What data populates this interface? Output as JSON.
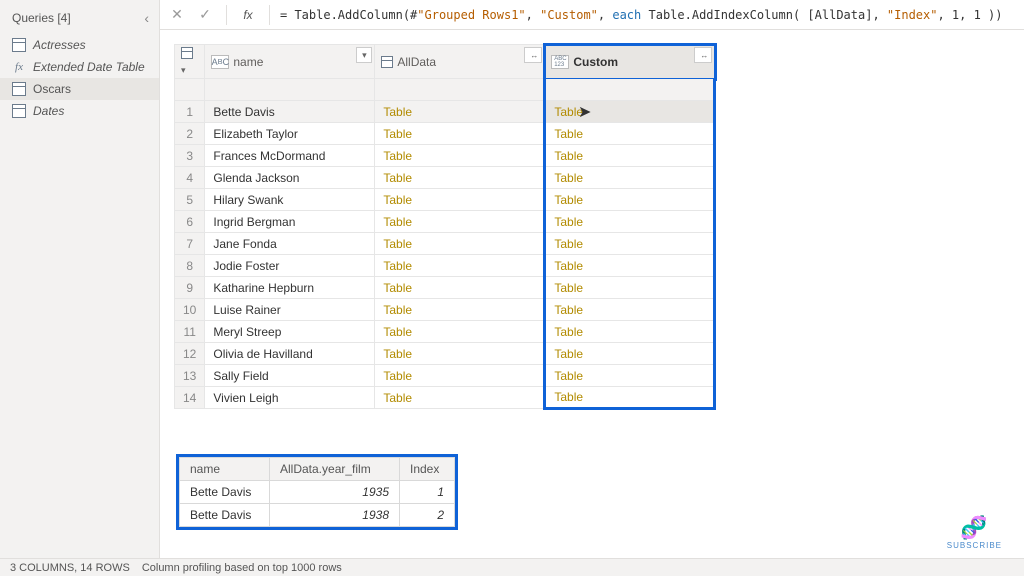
{
  "sidebar": {
    "header": "Queries [4]",
    "items": [
      {
        "label": "Actresses",
        "icon": "table"
      },
      {
        "label": "Extended Date Table",
        "icon": "fx"
      },
      {
        "label": "Oscars",
        "icon": "table"
      },
      {
        "label": "Dates",
        "icon": "table"
      }
    ]
  },
  "formula": {
    "prefix": "= Table.AddColumn(#",
    "s1": "\"Grouped Rows1\"",
    "c1": ", ",
    "s2": "\"Custom\"",
    "c2": ", ",
    "kw": "each",
    "rest": " Table.AddIndexColumn( [AllData], ",
    "s3": "\"Index\"",
    "tail": ", 1, 1 ))"
  },
  "grid": {
    "columns": {
      "name": "name",
      "alldata": "AllData",
      "custom": "Custom"
    },
    "typeIcons": {
      "text": "ABC",
      "any": "ABC\n123"
    },
    "linkText": "Table",
    "rows": [
      {
        "n": "1",
        "name": "Bette Davis"
      },
      {
        "n": "2",
        "name": "Elizabeth Taylor"
      },
      {
        "n": "3",
        "name": "Frances McDormand"
      },
      {
        "n": "4",
        "name": "Glenda Jackson"
      },
      {
        "n": "5",
        "name": "Hilary Swank"
      },
      {
        "n": "6",
        "name": "Ingrid Bergman"
      },
      {
        "n": "7",
        "name": "Jane Fonda"
      },
      {
        "n": "8",
        "name": "Jodie Foster"
      },
      {
        "n": "9",
        "name": "Katharine Hepburn"
      },
      {
        "n": "10",
        "name": "Luise Rainer"
      },
      {
        "n": "11",
        "name": "Meryl Streep"
      },
      {
        "n": "12",
        "name": "Olivia de Havilland"
      },
      {
        "n": "13",
        "name": "Sally Field"
      },
      {
        "n": "14",
        "name": "Vivien Leigh"
      }
    ]
  },
  "preview": {
    "headers": {
      "name": "name",
      "year": "AllData.year_film",
      "index": "Index"
    },
    "rows": [
      {
        "name": "Bette Davis",
        "year": "1935",
        "index": "1"
      },
      {
        "name": "Bette Davis",
        "year": "1938",
        "index": "2"
      }
    ]
  },
  "status": {
    "cols": "3 COLUMNS, 14 ROWS",
    "profile": "Column profiling based on top 1000 rows"
  },
  "logo": "SUBSCRIBE"
}
